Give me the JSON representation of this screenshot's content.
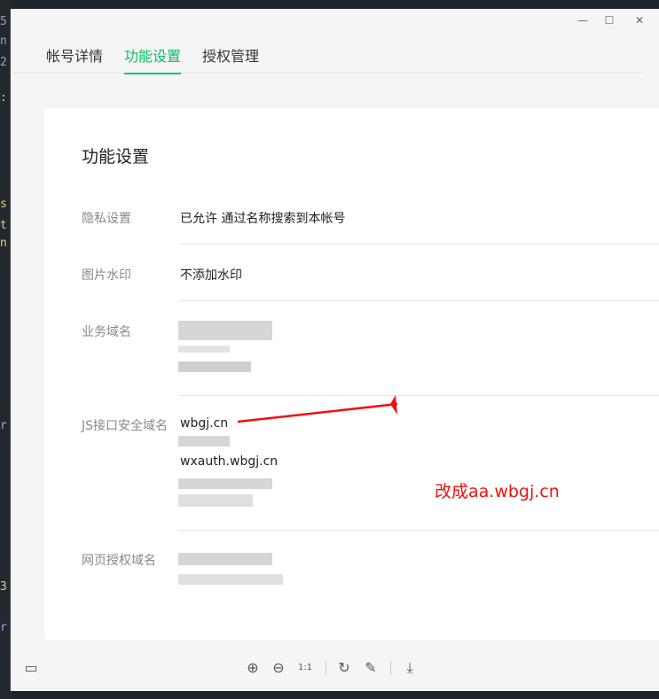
{
  "window": {
    "minimize": "—",
    "maximize": "☐",
    "close": "✕"
  },
  "tabs": [
    {
      "label": "帐号详情",
      "active": false
    },
    {
      "label": "功能设置",
      "active": true
    },
    {
      "label": "授权管理",
      "active": false
    }
  ],
  "card": {
    "title": "功能设置",
    "rows": {
      "privacy": {
        "label": "隐私设置",
        "value": "已允许 通过名称搜索到本帐号"
      },
      "watermark": {
        "label": "图片水印",
        "value": "不添加水印"
      },
      "business_domain": {
        "label": "业务域名"
      },
      "js_domain": {
        "label": "JS接口安全域名",
        "values": [
          "wbgj.cn",
          "wxauth.wbgj.cn"
        ]
      },
      "oauth_domain": {
        "label": "网页授权域名"
      }
    }
  },
  "annotation": {
    "text": "改成aa.wbgj.cn",
    "color": "#f01010"
  },
  "toolbar": [
    "layout-icon",
    "zoom-in-icon",
    "zoom-out-icon",
    "actual-size-icon",
    "rotate-icon",
    "edit-icon",
    "download-icon"
  ],
  "colors": {
    "accent": "#07c160"
  }
}
